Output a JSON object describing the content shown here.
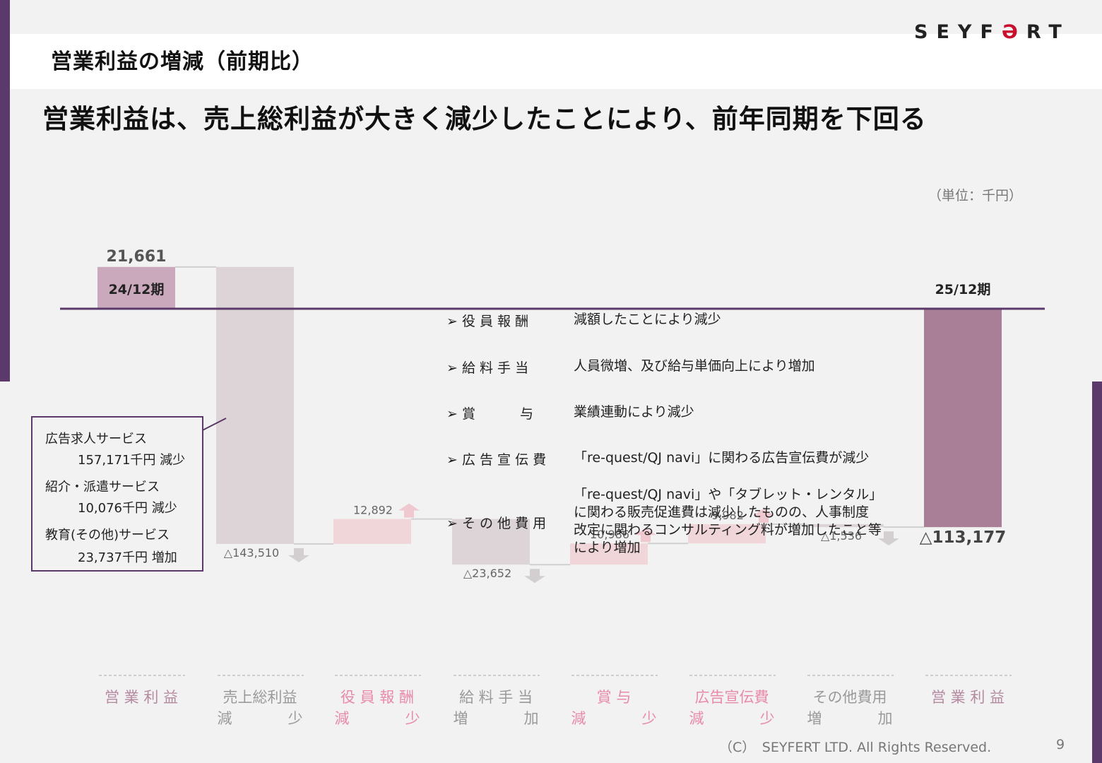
{
  "header": {
    "title": "営業利益の増減（前期比）",
    "logo": "SEYFERT",
    "subtitle": "営業利益は、売上総利益が大きく減少したことにより、前年同期を下回る",
    "unit": "（単位：千円）"
  },
  "chart_data": {
    "type": "waterfall",
    "ylabel": "",
    "start": {
      "period": "24/12期",
      "value": 21661,
      "value_label": "21,661"
    },
    "end": {
      "period": "25/12期",
      "value": -113177,
      "value_label": "△113,177"
    },
    "steps": [
      {
        "name": "売上総利益 減少",
        "value": -143510,
        "value_label": "△143,510",
        "arrow": "down"
      },
      {
        "name": "役員報酬 減少",
        "value": 12892,
        "value_label": "12,892",
        "arrow": "up"
      },
      {
        "name": "給料手当 増加",
        "value": -23652,
        "value_label": "△23,652",
        "arrow": "down"
      },
      {
        "name": "賞与 減少",
        "value": 10986,
        "value_label": "10,986",
        "arrow": "up"
      },
      {
        "name": "広告宣伝費 減少",
        "value": 9982,
        "value_label": "9,982",
        "arrow": "up"
      },
      {
        "name": "その他費用 増加",
        "value": -1536,
        "value_label": "△1,536",
        "arrow": "down"
      }
    ],
    "categories": [
      {
        "line1": "営 業 利 益",
        "line2_left": "",
        "line2_right": "",
        "color": "#b48aa0"
      },
      {
        "line1": "売上総利益",
        "line2_left": "減",
        "line2_right": "少",
        "color": "#9a9a9a"
      },
      {
        "line1": "役 員 報 酬",
        "line2_left": "減",
        "line2_right": "少",
        "color": "#e88aa8"
      },
      {
        "line1": "給 料 手 当",
        "line2_left": "増",
        "line2_right": "加",
        "color": "#9a9a9a"
      },
      {
        "line1": "賞 与",
        "line2_left": "減",
        "line2_right": "少",
        "color": "#e88aa8"
      },
      {
        "line1": "広告宣伝費",
        "line2_left": "減",
        "line2_right": "少",
        "color": "#e88aa8"
      },
      {
        "line1": "その他費用",
        "line2_left": "増",
        "line2_right": "加",
        "color": "#9a9a9a"
      },
      {
        "line1": "営 業 利 益",
        "line2_left": "",
        "line2_right": "",
        "color": "#b48aa0"
      }
    ],
    "colors": {
      "start_bar": "#c9a9bb",
      "end_bar": "#a97f97",
      "decrease_bar": "#dcd4d6",
      "increase_bar": "#f0d5d9",
      "axis": "#5b3a6b",
      "arrow_up": "#f0c8cf",
      "arrow_down": "#d3cfd0"
    }
  },
  "notes": [
    {
      "label": "役 員 報 酬",
      "text": "減額したことにより減少"
    },
    {
      "label": "給 料 手 当",
      "text": "人員微増、及び給与単価向上により増加"
    },
    {
      "label": "賞　　　 与",
      "text": "業績連動により減少"
    },
    {
      "label": "広 告 宣 伝 費",
      "text": "「re-quest/QJ navi」に関わる広告宣伝費が減少"
    },
    {
      "label": "そ の 他 費 用",
      "text": "「re-quest/QJ navi」や「タブレット・レンタル」\nに関わる販売促進費は減少したものの、人事制度\n改定に関わるコンサルティング料が増加したこと等\nにより増加"
    }
  ],
  "callout": {
    "item1_name": "広告求人サービス",
    "item1_value": "157,171千円 減少",
    "item2_name": "紹介・派遣サービス",
    "item2_value": "10,076千円 減少",
    "item3_name": "教育(その他)サービス",
    "item3_value": "23,737千円 増加"
  },
  "footer": {
    "copyright": "（C）　SEYFERT LTD. All Rights Reserved.",
    "page": "9"
  }
}
